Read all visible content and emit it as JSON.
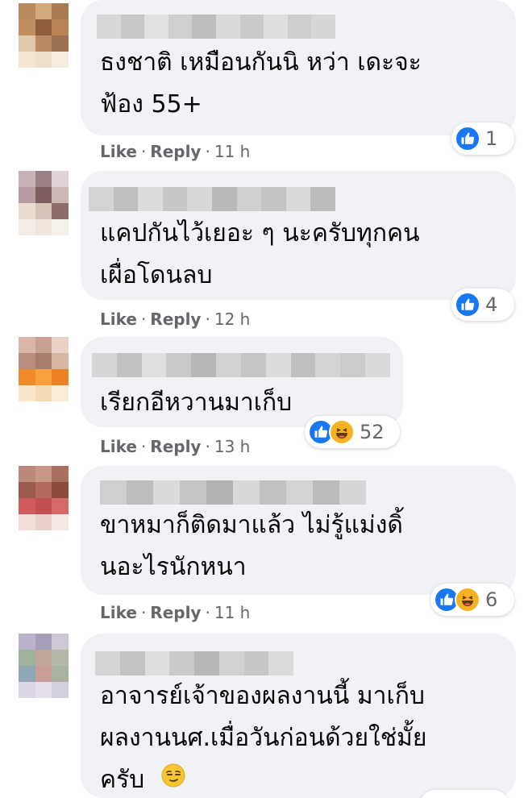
{
  "colors": {
    "bubble": "#f0f2f5",
    "text": "#050505",
    "meta": "#65676b",
    "like_blue": "#1877f2",
    "haha_yellow": "#f7b125"
  },
  "comments": [
    {
      "text_lines": [
        "ธงชาติ เหมือนกันนิ หว่า เดะจะ",
        "ฟ้อง 55+"
      ],
      "like_label": "Like",
      "reply_label": "Reply",
      "time": "11 h",
      "reaction_icons": [
        "like-icon"
      ],
      "reaction_count": "1"
    },
    {
      "text_lines": [
        "แคปกันไว้เยอะ ๆ นะครับทุกคน",
        "เผื่อโดนลบ"
      ],
      "like_label": "Like",
      "reply_label": "Reply",
      "time": "12 h",
      "reaction_icons": [
        "like-icon"
      ],
      "reaction_count": "4"
    },
    {
      "text_lines": [
        "เรียกอีหวานมาเก็บ"
      ],
      "like_label": "Like",
      "reply_label": "Reply",
      "time": "13 h",
      "reaction_icons": [
        "like-icon",
        "haha-icon"
      ],
      "reaction_count": "52"
    },
    {
      "text_lines": [
        "ขาหมาก็ติดมาแล้ว ไม่รู้แม่งดิ้",
        "นอะไรนักหนา"
      ],
      "like_label": "Like",
      "reply_label": "Reply",
      "time": "11 h",
      "reaction_icons": [
        "like-icon",
        "haha-icon"
      ],
      "reaction_count": "6"
    },
    {
      "text_lines": [
        "อาจารย์เจ้าของผลงานนี้ มาเก็บ",
        "ผลงานนศ.เมื่อวันก่อนด้วยใช่มั้ย",
        "ครับ"
      ],
      "trailing_emoji": "smirk-emoji-icon"
    }
  ]
}
